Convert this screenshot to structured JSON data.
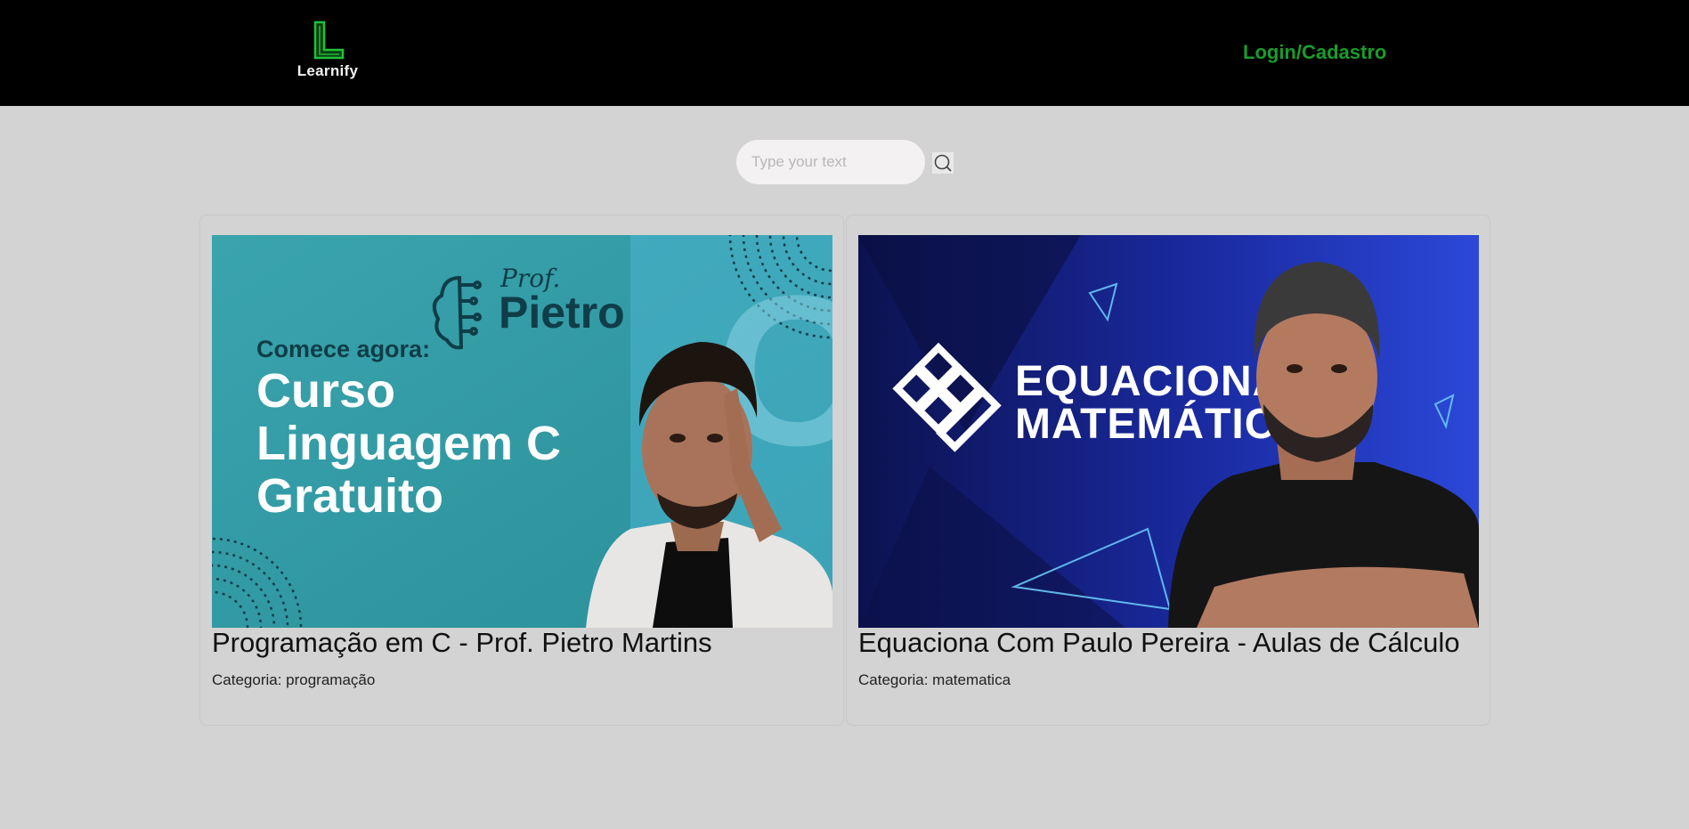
{
  "header": {
    "logo_letter": "L",
    "logo_text": "Learnify",
    "login_label": "Login/Cadastro",
    "colors": {
      "background": "#000000",
      "accent": "#1a9c2b"
    }
  },
  "search": {
    "placeholder": "Type your text",
    "value": "",
    "icon": "search-icon"
  },
  "courses": [
    {
      "thumbnail": {
        "brand_top": "Prof.",
        "brand_name": "Pietro",
        "kicker": "Comece agora:",
        "lines": [
          "Curso",
          "Linguagem C",
          "Gratuito"
        ],
        "big_letter": "C"
      },
      "title": "Programação em C - Prof. Pietro Martins",
      "category": "Categoria: programação"
    },
    {
      "thumbnail": {
        "lines": [
          "EQUACIONA",
          "MATEMÁTICA"
        ]
      },
      "title": "Equaciona Com Paulo Pereira - Aulas de Cálculo",
      "category": "Categoria: matematica"
    }
  ]
}
